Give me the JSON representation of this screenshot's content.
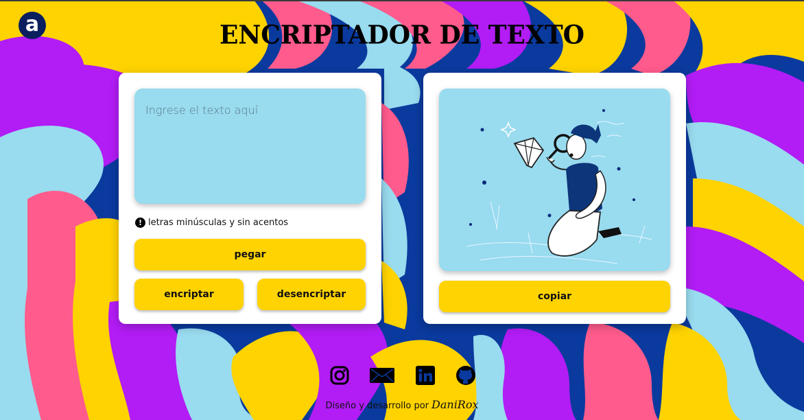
{
  "page": {
    "title": "ENCRIPTADOR DE TEXTO"
  },
  "logo": {
    "letter": "a",
    "icon": "alura-logo-icon"
  },
  "input": {
    "placeholder": "Ingrese el texto aquí",
    "value": ""
  },
  "hint": {
    "icon": "exclamation-icon",
    "text": "letras minúsculas y sin acentos"
  },
  "buttons": {
    "paste": "pegar",
    "encrypt": "encriptar",
    "decrypt": "desencriptar",
    "copy": "copiar"
  },
  "output": {
    "illustration": "person-with-magnifier-diamond-illustration"
  },
  "social": [
    {
      "icon": "instagram-icon"
    },
    {
      "icon": "mail-icon"
    },
    {
      "icon": "linkedin-icon"
    },
    {
      "icon": "github-icon"
    }
  ],
  "footer": {
    "credit": "Diseño y desarrollo por",
    "author": "DaniRox"
  },
  "colors": {
    "blue": "#0a3a9e",
    "purple": "#b21cf5",
    "pink": "#ff5b8c",
    "yellow": "#ffd300",
    "light_blue": "#99dbef",
    "button": "#ffd300"
  }
}
